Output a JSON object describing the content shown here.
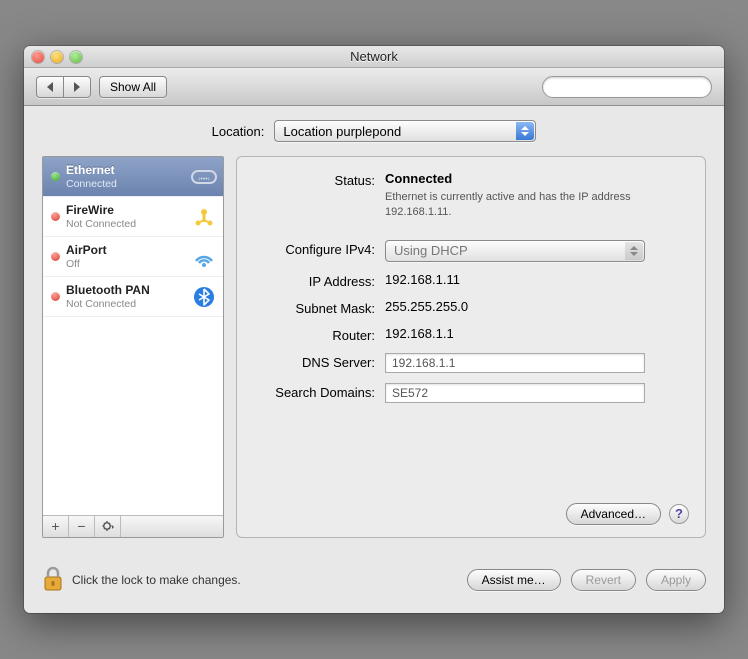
{
  "window": {
    "title": "Network"
  },
  "toolbar": {
    "show_all": "Show All",
    "search_placeholder": ""
  },
  "location": {
    "label": "Location:",
    "value": "Location purplepond"
  },
  "sidebar": {
    "items": [
      {
        "name": "Ethernet",
        "sub": "Connected",
        "status": "green",
        "icon": "ethernet",
        "selected": true
      },
      {
        "name": "FireWire",
        "sub": "Not Connected",
        "status": "red",
        "icon": "firewire",
        "selected": false
      },
      {
        "name": "AirPort",
        "sub": "Off",
        "status": "red",
        "icon": "airport",
        "selected": false
      },
      {
        "name": "Bluetooth PAN",
        "sub": "Not Connected",
        "status": "red",
        "icon": "bluetooth",
        "selected": false
      }
    ]
  },
  "details": {
    "status_label": "Status:",
    "status_value": "Connected",
    "status_desc": "Ethernet is currently active and has the IP address 192.168.1.11.",
    "configure_label": "Configure IPv4:",
    "configure_value": "Using DHCP",
    "ip_label": "IP Address:",
    "ip_value": "192.168.1.11",
    "subnet_label": "Subnet Mask:",
    "subnet_value": "255.255.255.0",
    "router_label": "Router:",
    "router_value": "192.168.1.1",
    "dns_label": "DNS Server:",
    "dns_value": "192.168.1.1",
    "search_label": "Search Domains:",
    "search_value": "SE572",
    "advanced": "Advanced…"
  },
  "bottom": {
    "lock_text": "Click the lock to make changes.",
    "assist": "Assist me…",
    "revert": "Revert",
    "apply": "Apply"
  }
}
